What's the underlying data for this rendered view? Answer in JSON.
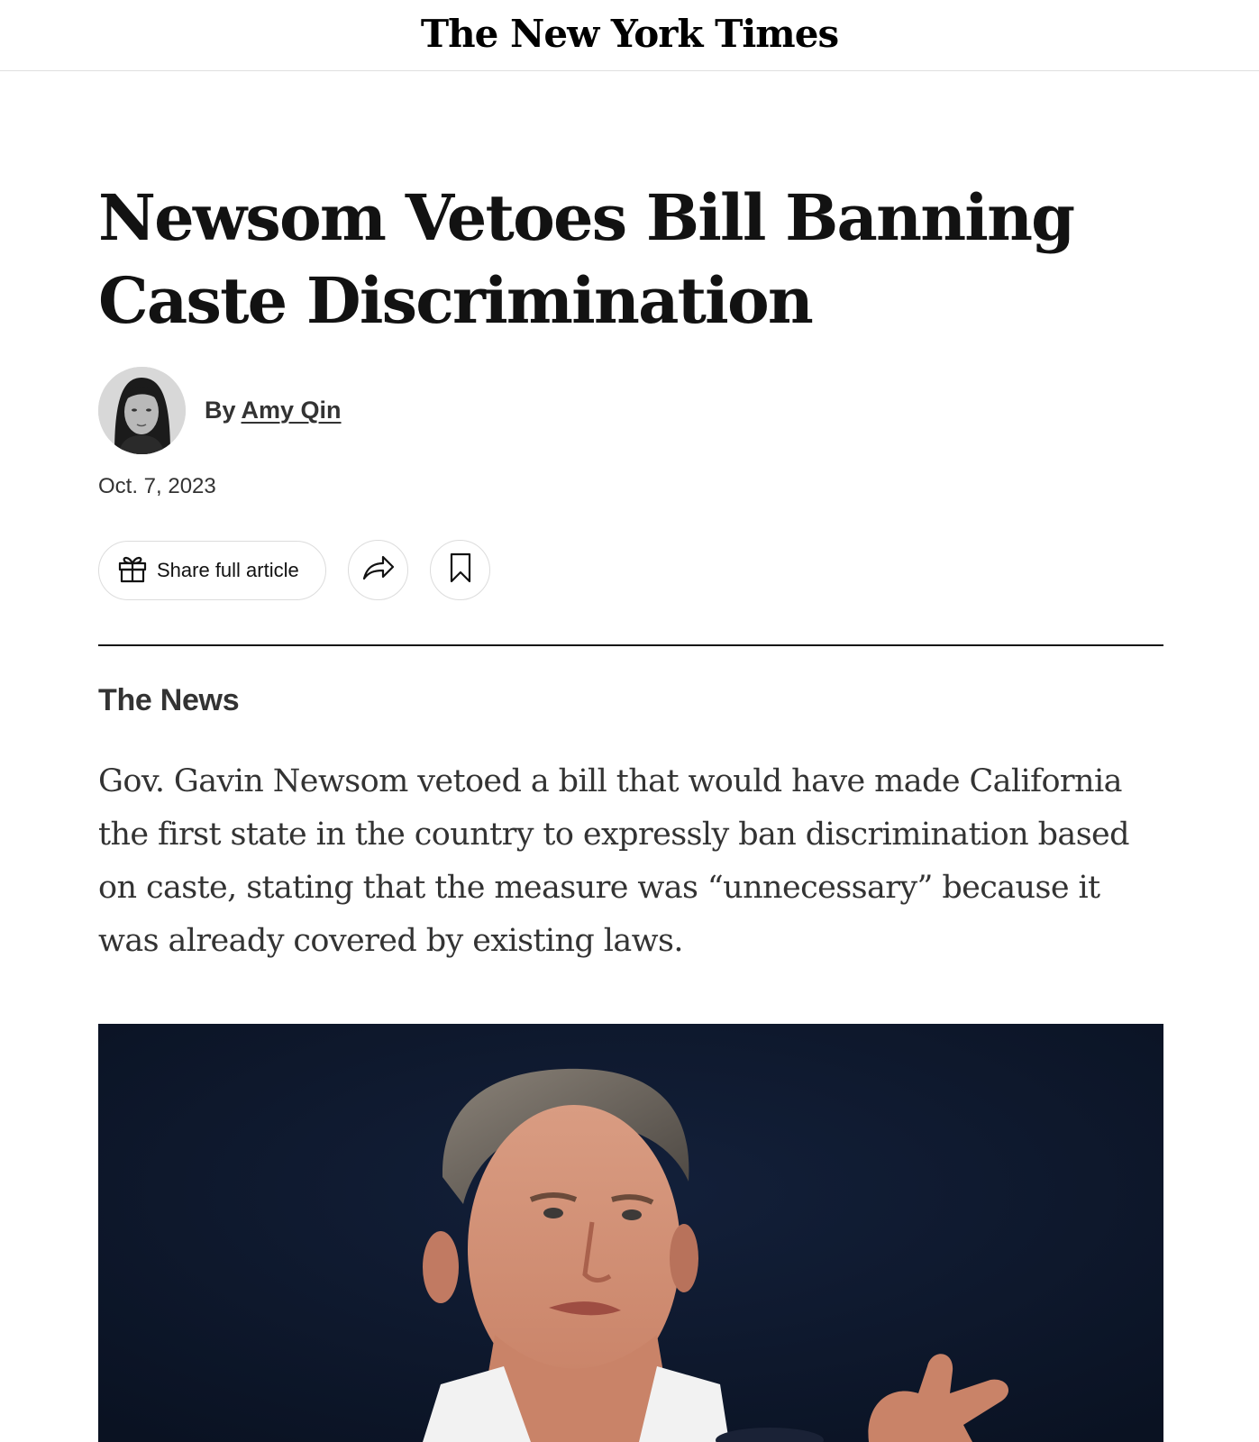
{
  "masthead": {
    "logo_text": "The New York Times"
  },
  "article": {
    "headline": "Newsom Vetoes Bill Banning Caste Discrimination",
    "byline_prefix": "By",
    "author": "Amy Qin",
    "date": "Oct. 7, 2023",
    "section_label": "The News",
    "summary": "Gov. Gavin Newsom vetoed a bill that would have made California the first state in the country to expressly ban discrimination based on caste, stating that the measure was “unnecessary” because it was already covered by existing laws."
  },
  "actions": {
    "share_label": "Share full article",
    "icons": [
      "gift-icon",
      "forward-arrow-icon",
      "bookmark-icon"
    ]
  },
  "colors": {
    "text": "#121212",
    "secondary_text": "#333333",
    "border": "#dcdcdc",
    "photo_background": "#0c1628"
  }
}
